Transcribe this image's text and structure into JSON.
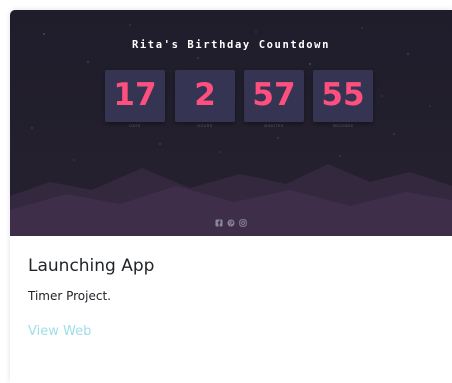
{
  "hero": {
    "title": "Rita's Birthday Countdown",
    "timer": [
      {
        "value": "17",
        "label": "DAYS"
      },
      {
        "value": "2",
        "label": "HOURS"
      },
      {
        "value": "57",
        "label": "MINUTES"
      },
      {
        "value": "55",
        "label": "SECONDS"
      }
    ],
    "social_icons": [
      "facebook-icon",
      "pinterest-icon",
      "instagram-icon"
    ]
  },
  "card": {
    "title": "Launching App",
    "description": "Timer Project.",
    "link_label": "View Web"
  },
  "colors": {
    "hero_bg": "#1f1d2b",
    "timer_box": "#353553",
    "timer_number": "#ff4f7f",
    "link": "#a0dde8",
    "mountains": "#3a2b45"
  }
}
